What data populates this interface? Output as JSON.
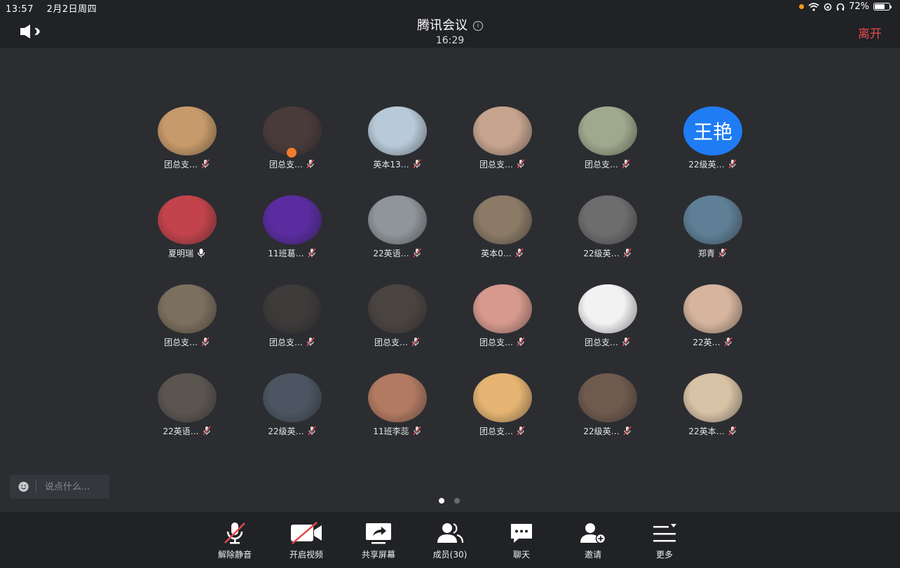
{
  "status_bar": {
    "time": "13:57",
    "date": "2月2日周四",
    "battery": "72%",
    "battery_level": 0.72
  },
  "header": {
    "title": "腾讯会议",
    "timer": "16:29",
    "leave": "离开"
  },
  "participants": [
    {
      "name": "团总支…",
      "muted": true,
      "avatar": "photo",
      "color": "#c79a6b"
    },
    {
      "name": "团总支…",
      "muted": true,
      "avatar": "photo",
      "color": "#4a3b3b",
      "host": true
    },
    {
      "name": "英本13…",
      "muted": true,
      "avatar": "photo",
      "color": "#b8c9d8"
    },
    {
      "name": "团总支…",
      "muted": true,
      "avatar": "photo",
      "color": "#c7a48f"
    },
    {
      "name": "团总支…",
      "muted": true,
      "avatar": "photo",
      "color": "#9fa98d"
    },
    {
      "name": "22级英…",
      "muted": true,
      "avatar": "text",
      "initials": "王艳"
    },
    {
      "name": "夏明瑞",
      "muted": false,
      "avatar": "photo",
      "color": "#c2434b"
    },
    {
      "name": "11班葛…",
      "muted": true,
      "avatar": "photo",
      "color": "#5a2ca0"
    },
    {
      "name": "22英语…",
      "muted": true,
      "avatar": "photo",
      "color": "#8f959a"
    },
    {
      "name": "英本0…",
      "muted": true,
      "avatar": "photo",
      "color": "#8b7a66"
    },
    {
      "name": "22级英…",
      "muted": true,
      "avatar": "photo",
      "color": "#6d6d6d"
    },
    {
      "name": "郑青",
      "muted": true,
      "avatar": "photo",
      "color": "#5f7f96"
    },
    {
      "name": "团总支…",
      "muted": true,
      "avatar": "photo",
      "color": "#7b6f5e"
    },
    {
      "name": "团总支…",
      "muted": true,
      "avatar": "photo",
      "color": "#3d3a3a"
    },
    {
      "name": "团总支…",
      "muted": true,
      "avatar": "photo",
      "color": "#4a4440"
    },
    {
      "name": "团总支…",
      "muted": true,
      "avatar": "photo",
      "color": "#d7998d"
    },
    {
      "name": "团总支…",
      "muted": true,
      "avatar": "photo",
      "color": "#f2f2f2"
    },
    {
      "name": "22英…",
      "muted": true,
      "avatar": "photo",
      "color": "#d6b49d"
    },
    {
      "name": "22英语…",
      "muted": true,
      "avatar": "photo",
      "color": "#5b5550"
    },
    {
      "name": "22级英…",
      "muted": true,
      "avatar": "photo",
      "color": "#4c5662"
    },
    {
      "name": "11班李蕊",
      "muted": true,
      "avatar": "photo",
      "color": "#b27a62"
    },
    {
      "name": "团总支…",
      "muted": true,
      "avatar": "photo",
      "color": "#e5b473"
    },
    {
      "name": "22级英…",
      "muted": true,
      "avatar": "photo",
      "color": "#6f5a4e"
    },
    {
      "name": "22英本…",
      "muted": true,
      "avatar": "photo",
      "color": "#d9c3a6"
    }
  ],
  "chat": {
    "placeholder": "说点什么..."
  },
  "pager": {
    "pages": 2,
    "current": 1
  },
  "toolbar": {
    "unmute": "解除静音",
    "start_video": "开启视频",
    "share_screen": "共享屏幕",
    "members": "成员(30)",
    "chat": "聊天",
    "invite": "邀请",
    "more": "更多"
  },
  "colors": {
    "leave": "#e5484d",
    "text_avatar": "#1f7cf5",
    "muted_slash": "#e5484d",
    "host_badge": "#f07c2b"
  }
}
